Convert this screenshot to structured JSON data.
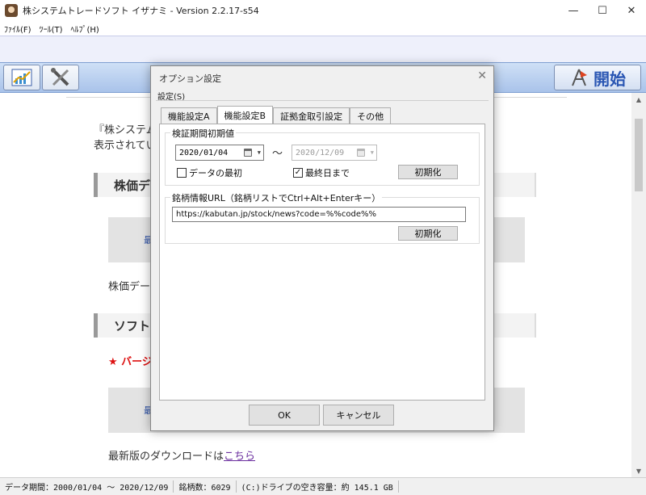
{
  "window": {
    "title": "株システムトレードソフト イザナミ - Version 2.2.17-s54",
    "minimize": "—",
    "maximize": "☐",
    "close": "✕"
  },
  "menu": {
    "file": "ﾌｧｲﾙ(F)",
    "tool": "ﾂｰﾙ(T)",
    "help": "ﾍﾙﾌﾟ(H)"
  },
  "toolbar": {
    "start_label": "開始",
    "chart_icon": "chart-icon",
    "tools_icon": "wrench-icon"
  },
  "content": {
    "intro_line1": "『株システム",
    "intro_line2": "表示されてい",
    "heading1": "株価デ",
    "panel1_text": "最",
    "body1": "株価デー",
    "heading2": "ソフト",
    "version_note": "★ バージ",
    "panel2_text": "最",
    "download_text": "最新版のダウンロードは",
    "download_link": "こちら"
  },
  "dialog": {
    "title": "オプション設定",
    "close": "✕",
    "menu": "設定(S)",
    "tabs": [
      "機能設定A",
      "機能設定B",
      "証拠金取引設定",
      "その他"
    ],
    "active_tab": 1,
    "group1": {
      "title": "検証期間初期値",
      "start_date": "2020/01/04",
      "range_sep": "～",
      "end_date": "2020/12/09",
      "check_data_start": "データの最初",
      "check_data_start_checked": false,
      "check_last_day": "最終日まで",
      "check_last_day_checked": true,
      "reset_label": "初期化"
    },
    "group2": {
      "title": "銘柄情報URL（銘柄リストでCtrl+Alt+Enterキー）",
      "url": "https://kabutan.jp/stock/news?code=%%code%%",
      "reset_label": "初期化"
    },
    "ok_label": "OK",
    "cancel_label": "キャンセル",
    "check_mark": "✓"
  },
  "status": {
    "period": "データ期間：2000/01/04 ～ 2020/12/09",
    "count": "銘柄数：6029",
    "drive": "(C:)ドライブの空き容量：約 145.1 GB"
  },
  "colors": {
    "toolbar_gradient_top": "#cfe0f6",
    "toolbar_gradient_bottom": "#a9c3ea",
    "start_label": "#2a56b3",
    "version_note": "#dd1111",
    "link": "#6a2d9e"
  }
}
